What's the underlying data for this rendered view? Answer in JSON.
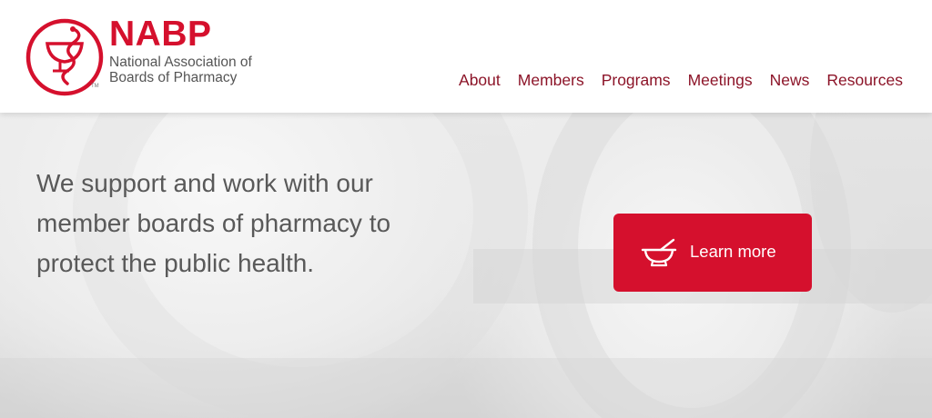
{
  "brand": {
    "name": "NABP",
    "subtitle_line1": "National Association of",
    "subtitle_line2": "Boards of Pharmacy",
    "trademark": "TM",
    "color": "#d5102d",
    "logo_icon": "bowl-of-hygieia-icon"
  },
  "nav": {
    "color": "#8c1428",
    "items": [
      {
        "label": "About"
      },
      {
        "label": "Members"
      },
      {
        "label": "Programs"
      },
      {
        "label": "Meetings"
      },
      {
        "label": "News"
      },
      {
        "label": "Resources"
      }
    ]
  },
  "hero": {
    "headline_line1": "We support and work with our",
    "headline_line2": "member boards of pharmacy to",
    "headline_line3": "protect the public health.",
    "cta": {
      "label": "Learn more",
      "icon": "mortar-and-pestle-icon",
      "color": "#d5102d"
    }
  }
}
